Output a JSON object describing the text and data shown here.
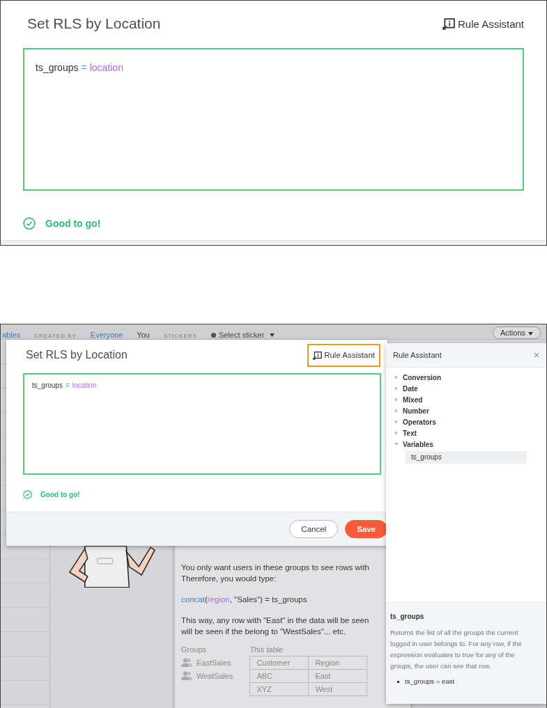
{
  "zoomed_dialog": {
    "title": "Set RLS by Location",
    "rule_assistant_button": "Rule Assistant",
    "editor": {
      "tokens": [
        {
          "text": "ts_groups",
          "kind": "variable"
        },
        {
          "text": "=",
          "kind": "operator"
        },
        {
          "text": "location",
          "kind": "column"
        }
      ]
    },
    "status": {
      "text": "Good to go!",
      "kind": "ok"
    }
  },
  "screen": {
    "header": {
      "items": [
        {
          "text": "ables",
          "kind": "link"
        },
        {
          "text": "CREATED BY",
          "kind": "label"
        },
        {
          "text": "Everyone",
          "kind": "link"
        },
        {
          "text": "You",
          "kind": "plain"
        },
        {
          "text": "STICKERS",
          "kind": "label"
        },
        {
          "text": "Select sticker",
          "kind": "dropdown"
        }
      ],
      "actions_button": "Actions"
    },
    "help_card": {
      "lines": [
        "You only want users in these groups to see rows with",
        "Therefore, you would type:"
      ],
      "code": [
        {
          "text": "concat",
          "kind": "function"
        },
        {
          "text": "(",
          "kind": "plain"
        },
        {
          "text": "region",
          "kind": "column"
        },
        {
          "text": ", \"Sales\") = ts_groups",
          "kind": "plain"
        }
      ],
      "after_lines": [
        "This way, any row with \"East\" in the data will be seen",
        "will be seen if the belong to \"WestSales\"... etc."
      ],
      "groups": {
        "heading": "Groups",
        "items": [
          "EastSales",
          "WestSales"
        ]
      },
      "table": {
        "heading": "This table",
        "columns": [
          "Customer",
          "Region"
        ],
        "rows": [
          [
            "ABC",
            "East"
          ],
          [
            "XYZ",
            "West"
          ]
        ]
      }
    },
    "dialog": {
      "title": "Set RLS by Location",
      "rule_assistant_button": {
        "label": "Rule Assistant",
        "highlighted": true
      },
      "editor": {
        "tokens": [
          {
            "text": "ts_groups",
            "kind": "variable"
          },
          {
            "text": "=",
            "kind": "operator"
          },
          {
            "text": "location",
            "kind": "column"
          }
        ]
      },
      "status": {
        "text": "Good to go!",
        "kind": "ok"
      },
      "buttons": [
        {
          "label": "Cancel",
          "kind": "secondary"
        },
        {
          "label": "Save",
          "kind": "primary"
        }
      ]
    },
    "rule_assistant": {
      "title": "Rule Assistant",
      "close": "×",
      "tree": [
        {
          "label": "Conversion",
          "expanded": false
        },
        {
          "label": "Date",
          "expanded": false
        },
        {
          "label": "Mixed",
          "expanded": false
        },
        {
          "label": "Number",
          "expanded": false
        },
        {
          "label": "Operators",
          "expanded": false
        },
        {
          "label": "Text",
          "expanded": false
        },
        {
          "label": "Variables",
          "expanded": true,
          "children": [
            {
              "label": "ts_groups",
              "selected": true
            }
          ]
        }
      ],
      "detail": {
        "title": "ts_groups",
        "text": "Returns the list of all the groups the current logged in user belongs to. For any row, if the expression evaluates to true for any of the groups, the user can see that row.",
        "examples": [
          "ts_groups = east"
        ]
      }
    }
  }
}
